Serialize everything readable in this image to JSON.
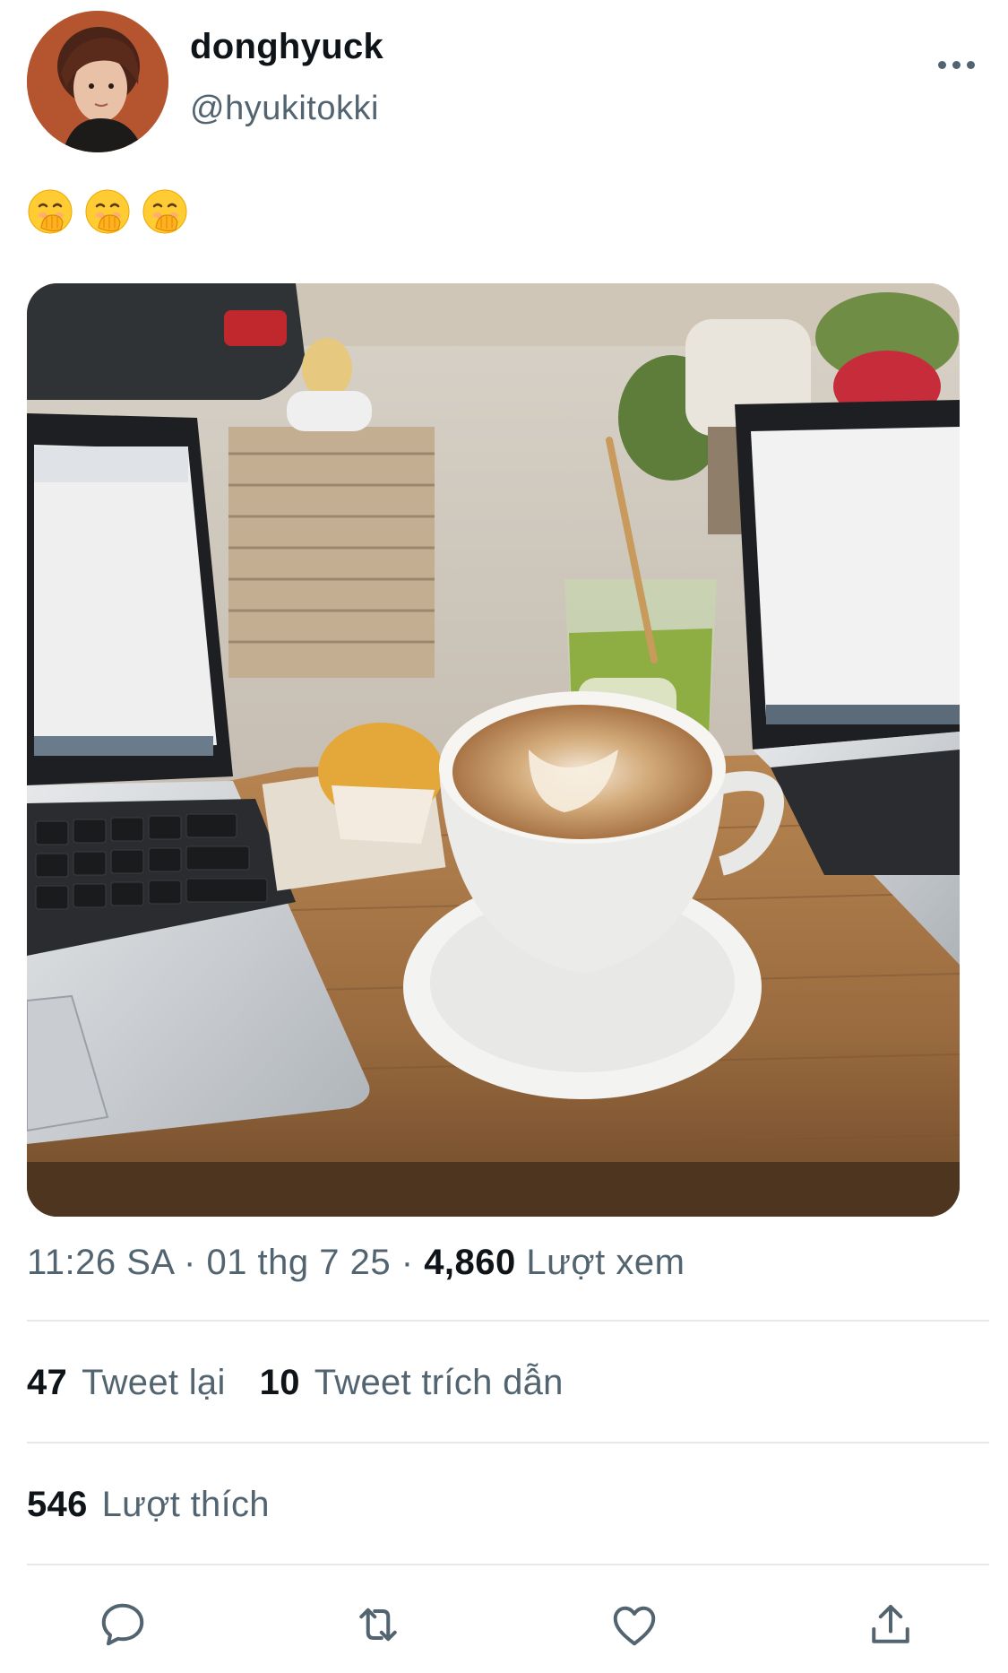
{
  "user": {
    "display_name": "donghyuck",
    "handle": "@hyukitokki"
  },
  "tweet": {
    "emojis": [
      "face-with-hand-over-mouth-emoji",
      "face-with-hand-over-mouth-emoji",
      "face-with-hand-over-mouth-emoji"
    ]
  },
  "meta": {
    "time": "11:26 SA",
    "sep1": " · ",
    "date": "01 thg 7 25",
    "sep2": " · ",
    "views_count": "4,860",
    "views_label": " Lượt xem"
  },
  "stats": {
    "retweets_count": "47",
    "retweets_label": "Tweet lại",
    "quotes_count": "10",
    "quotes_label": "Tweet trích dẫn",
    "likes_count": "546",
    "likes_label": "Lượt thích"
  },
  "colors": {
    "primary_text": "#0f1419",
    "secondary_text": "#536471",
    "divider": "#e6e9eb",
    "icon": "#536471"
  },
  "icons": {
    "more": "more-horizontal-icon",
    "reply": "reply-icon",
    "retweet": "retweet-icon",
    "like": "heart-icon",
    "share": "share-icon"
  }
}
